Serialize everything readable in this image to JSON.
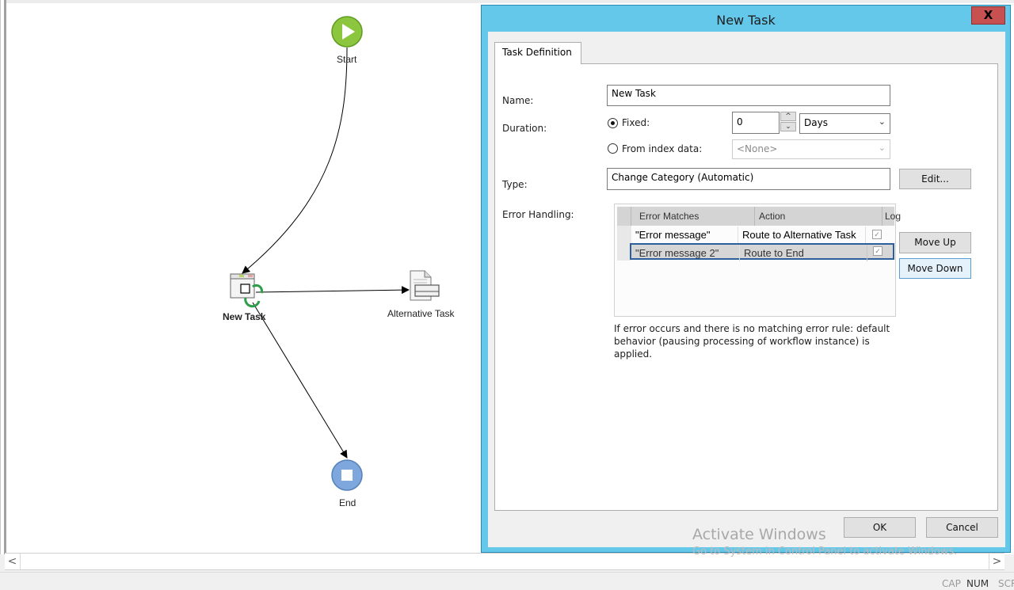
{
  "diagram": {
    "nodes": [
      {
        "id": "start",
        "label": "Start",
        "icon": "play-circle-icon"
      },
      {
        "id": "new_task",
        "label": "New Task",
        "icon": "automatic-task-icon"
      },
      {
        "id": "alt_task",
        "label": "Alternative Task",
        "icon": "document-task-icon"
      },
      {
        "id": "end",
        "label": "End",
        "icon": "stop-circle-icon"
      }
    ],
    "edges": [
      {
        "from": "start",
        "to": "new_task"
      },
      {
        "from": "new_task",
        "to": "alt_task"
      },
      {
        "from": "new_task",
        "to": "end"
      }
    ]
  },
  "scrollbar": {
    "left": "<",
    "right": ">"
  },
  "status": {
    "cap": "CAP",
    "num": "NUM",
    "scrl": "SCRL"
  },
  "dialog": {
    "title": "New Task",
    "close": "X",
    "tab": "Task Definition",
    "name_label": "Name:",
    "name_value": "New Task",
    "duration_label": "Duration:",
    "fixed_label": "Fixed:",
    "fixed_selected": true,
    "fixed_value": "0",
    "unit_value": "Days",
    "from_index_label": "From index data:",
    "from_index_value": "<None>",
    "type_label": "Type:",
    "type_value": "Change Category (Automatic)",
    "edit_button": "Edit...",
    "error_handling_label": "Error Handling:",
    "grid": {
      "columns": [
        "Error Matches",
        "Action",
        "Log"
      ],
      "rows": [
        {
          "match": "\"Error message\"",
          "action": "Route to Alternative Task",
          "log": true,
          "selected": false
        },
        {
          "match": "\"Error message 2\"",
          "action": "Route to End",
          "log": true,
          "selected": true
        }
      ]
    },
    "move_up": "Move Up",
    "move_down": "Move Down",
    "info": "If error occurs and there is no matching error rule: default behavior (pausing processing of workflow instance) is applied.",
    "ok": "OK",
    "cancel": "Cancel"
  },
  "watermark": {
    "title": "Activate Windows",
    "subtitle": "Go to System in Control Panel to activate Windows."
  }
}
